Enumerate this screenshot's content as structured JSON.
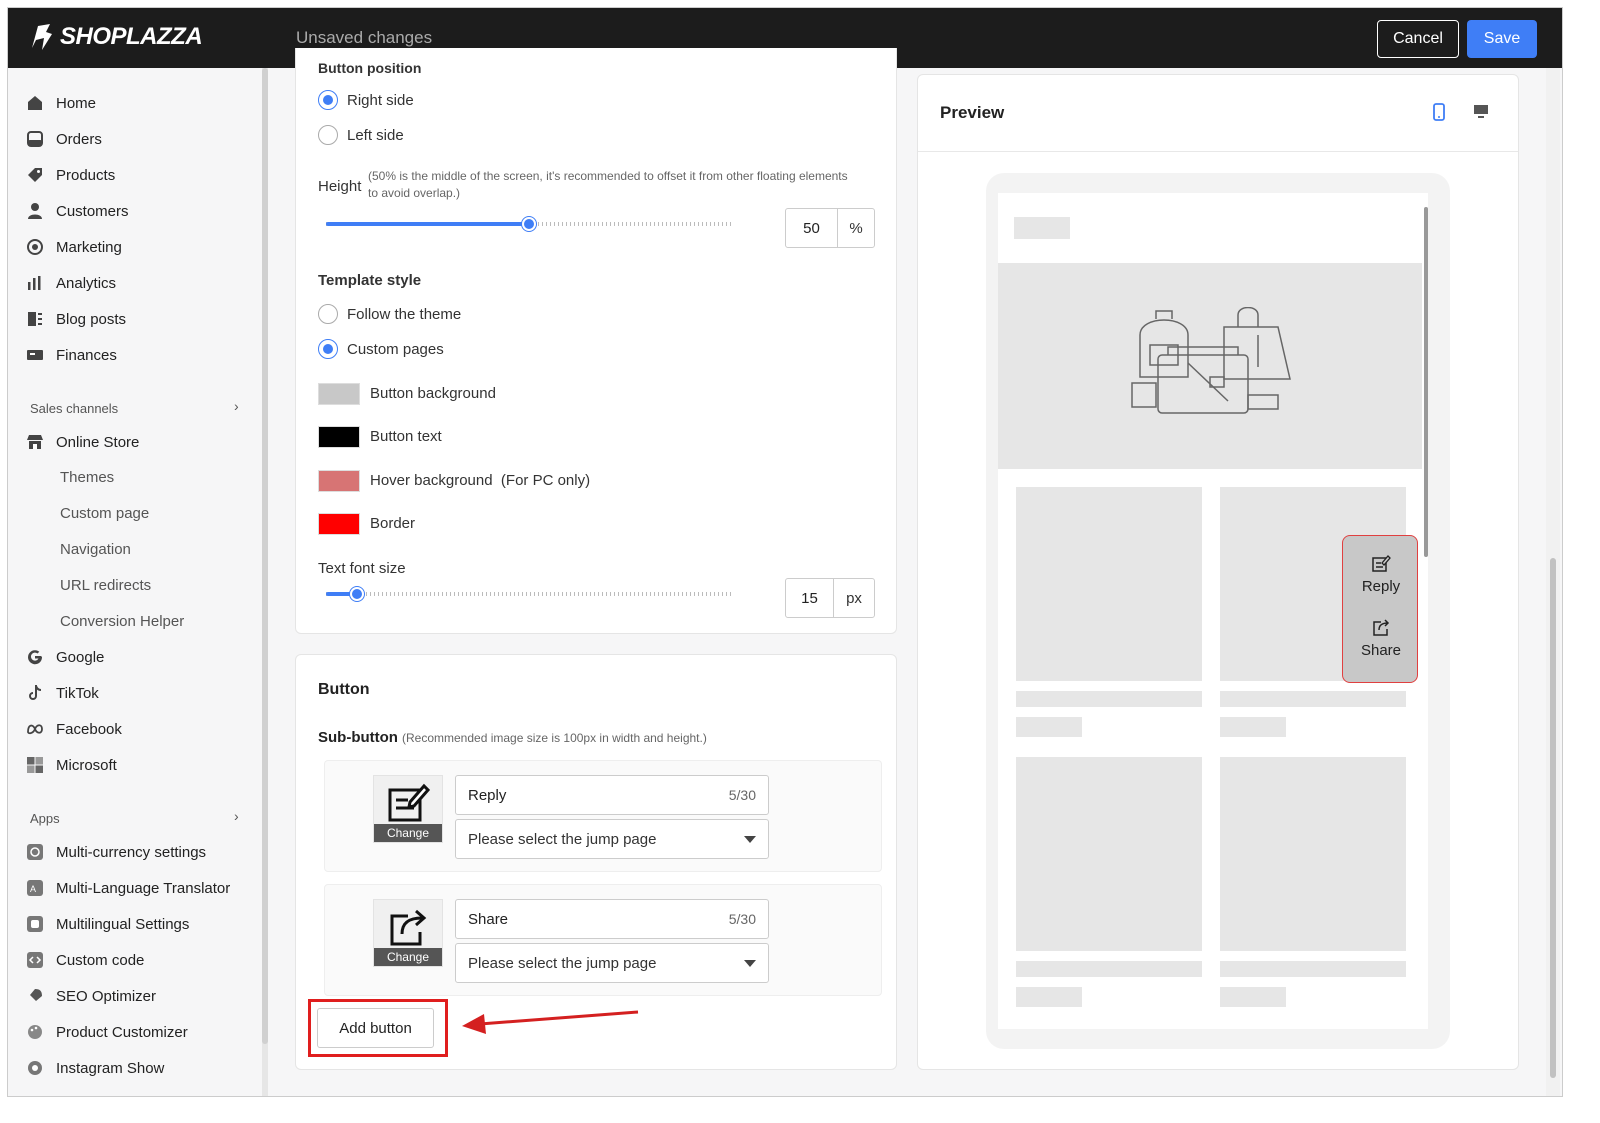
{
  "topbar": {
    "brand": "SHOPLAZZA",
    "status": "Unsaved changes",
    "cancel": "Cancel",
    "save": "Save"
  },
  "sidebar": {
    "main": [
      "Home",
      "Orders",
      "Products",
      "Customers",
      "Marketing",
      "Analytics",
      "Blog posts",
      "Finances"
    ],
    "sales_head": "Sales channels",
    "online_store": "Online Store",
    "online_sub": [
      "Themes",
      "Custom page",
      "Navigation",
      "URL redirects",
      "Conversion Helper"
    ],
    "channels": [
      "Google",
      "TikTok",
      "Facebook",
      "Microsoft"
    ],
    "apps_head": "Apps",
    "apps": [
      "Multi-currency settings",
      "Multi-Language Translator",
      "Multilingual Settings",
      "Custom code",
      "SEO Optimizer",
      "Product Customizer",
      "Instagram Show"
    ]
  },
  "settings": {
    "position_title": "Button position",
    "right_side": "Right side",
    "left_side": "Left side",
    "height_label": "Height",
    "height_hint": "(50% is the middle of the screen, it's recommended to offset it from other floating elements to avoid overlap.)",
    "height_value": "50",
    "height_unit": "%",
    "height_percent": 50,
    "template_title": "Template style",
    "follow_theme": "Follow the theme",
    "custom_pages": "Custom pages",
    "colors": [
      {
        "label": "Button background",
        "color": "#c8c8c8"
      },
      {
        "label": "Button text",
        "color": "#000000"
      },
      {
        "label": "Hover background  (For PC only)",
        "color": "#d77474"
      },
      {
        "label": "Border",
        "color": "#ff0000"
      }
    ],
    "font_label": "Text font size",
    "font_value": "15",
    "font_unit": "px"
  },
  "button_card": {
    "title": "Button",
    "sub_label": "Sub-button",
    "sub_hint": "(Recommended image size is 100px in width and height.)",
    "subs": [
      {
        "name": "Reply",
        "count": "5/30",
        "change": "Change",
        "jump": "Please select the jump page",
        "icon": "reply-icon"
      },
      {
        "name": "Share",
        "count": "5/30",
        "change": "Change",
        "jump": "Please select the jump page",
        "icon": "share-icon"
      }
    ],
    "add": "Add button"
  },
  "preview": {
    "title": "Preview",
    "float_items": [
      "Reply",
      "Share"
    ]
  }
}
